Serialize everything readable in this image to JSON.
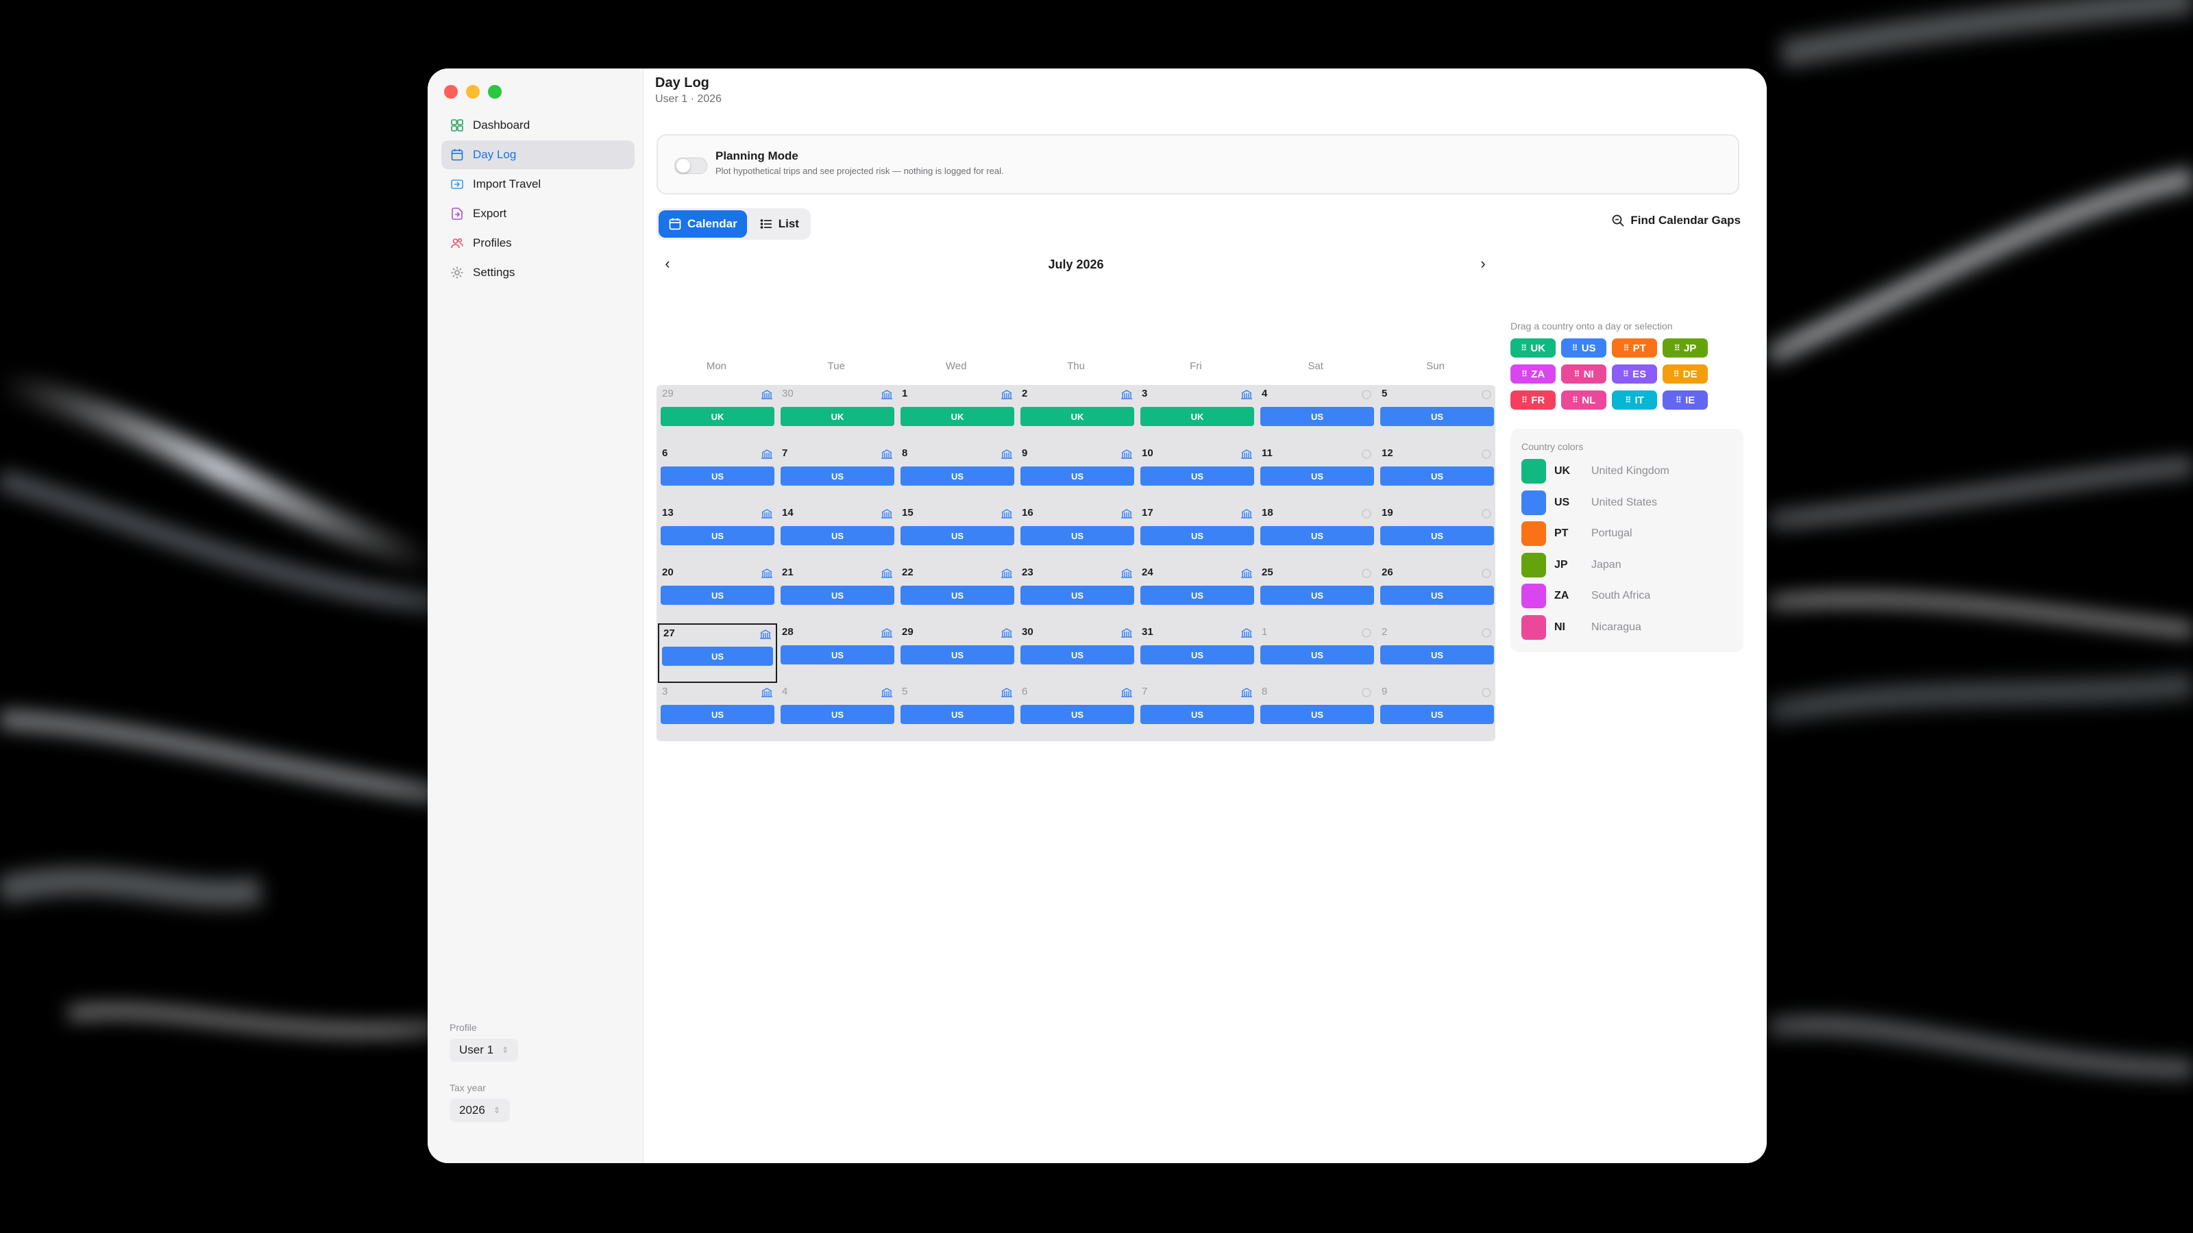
{
  "sidebar": {
    "items": [
      {
        "label": "Dashboard",
        "icon": "dashboard-icon"
      },
      {
        "label": "Day Log",
        "icon": "calendar-icon",
        "active": true
      },
      {
        "label": "Import Travel",
        "icon": "import-icon"
      },
      {
        "label": "Export",
        "icon": "export-icon"
      },
      {
        "label": "Profiles",
        "icon": "profiles-icon"
      },
      {
        "label": "Settings",
        "icon": "gear-icon"
      }
    ],
    "profile_label": "Profile",
    "profile_value": "User 1",
    "tax_year_label": "Tax year",
    "tax_year_value": "2026"
  },
  "header": {
    "title": "Day Log",
    "subtitle": "User 1 · 2026"
  },
  "planning": {
    "title": "Planning Mode",
    "description": "Plot hypothetical trips and see projected risk — nothing is logged for real.",
    "enabled": false
  },
  "view_toggle": {
    "calendar_label": "Calendar",
    "list_label": "List",
    "active": "calendar"
  },
  "find_gaps_label": "Find Calendar Gaps",
  "calendar": {
    "month_title": "July 2026",
    "weekdays": [
      "Mon",
      "Tue",
      "Wed",
      "Thu",
      "Fri",
      "Sat",
      "Sun"
    ],
    "selected_day": "27",
    "weeks": [
      [
        {
          "day": "29",
          "in_month": false,
          "country": "UK",
          "icon": true
        },
        {
          "day": "30",
          "in_month": false,
          "country": "UK",
          "icon": true
        },
        {
          "day": "1",
          "in_month": true,
          "country": "UK",
          "icon": true
        },
        {
          "day": "2",
          "in_month": true,
          "country": "UK",
          "icon": true
        },
        {
          "day": "3",
          "in_month": true,
          "country": "UK",
          "icon": true
        },
        {
          "day": "4",
          "in_month": true,
          "country": "US",
          "icon": false
        },
        {
          "day": "5",
          "in_month": true,
          "country": "US",
          "icon": false
        }
      ],
      [
        {
          "day": "6",
          "in_month": true,
          "country": "US",
          "icon": true
        },
        {
          "day": "7",
          "in_month": true,
          "country": "US",
          "icon": true
        },
        {
          "day": "8",
          "in_month": true,
          "country": "US",
          "icon": true
        },
        {
          "day": "9",
          "in_month": true,
          "country": "US",
          "icon": true
        },
        {
          "day": "10",
          "in_month": true,
          "country": "US",
          "icon": true
        },
        {
          "day": "11",
          "in_month": true,
          "country": "US",
          "icon": false
        },
        {
          "day": "12",
          "in_month": true,
          "country": "US",
          "icon": false
        }
      ],
      [
        {
          "day": "13",
          "in_month": true,
          "country": "US",
          "icon": true
        },
        {
          "day": "14",
          "in_month": true,
          "country": "US",
          "icon": true
        },
        {
          "day": "15",
          "in_month": true,
          "country": "US",
          "icon": true
        },
        {
          "day": "16",
          "in_month": true,
          "country": "US",
          "icon": true
        },
        {
          "day": "17",
          "in_month": true,
          "country": "US",
          "icon": true
        },
        {
          "day": "18",
          "in_month": true,
          "country": "US",
          "icon": false
        },
        {
          "day": "19",
          "in_month": true,
          "country": "US",
          "icon": false
        }
      ],
      [
        {
          "day": "20",
          "in_month": true,
          "country": "US",
          "icon": true
        },
        {
          "day": "21",
          "in_month": true,
          "country": "US",
          "icon": true
        },
        {
          "day": "22",
          "in_month": true,
          "country": "US",
          "icon": true
        },
        {
          "day": "23",
          "in_month": true,
          "country": "US",
          "icon": true
        },
        {
          "day": "24",
          "in_month": true,
          "country": "US",
          "icon": true
        },
        {
          "day": "25",
          "in_month": true,
          "country": "US",
          "icon": false
        },
        {
          "day": "26",
          "in_month": true,
          "country": "US",
          "icon": false
        }
      ],
      [
        {
          "day": "27",
          "in_month": true,
          "country": "US",
          "icon": true
        },
        {
          "day": "28",
          "in_month": true,
          "country": "US",
          "icon": true
        },
        {
          "day": "29",
          "in_month": true,
          "country": "US",
          "icon": true
        },
        {
          "day": "30",
          "in_month": true,
          "country": "US",
          "icon": true
        },
        {
          "day": "31",
          "in_month": true,
          "country": "US",
          "icon": true
        },
        {
          "day": "1",
          "in_month": false,
          "country": "US",
          "icon": false
        },
        {
          "day": "2",
          "in_month": false,
          "country": "US",
          "icon": false
        }
      ],
      [
        {
          "day": "3",
          "in_month": false,
          "country": "US",
          "icon": true
        },
        {
          "day": "4",
          "in_month": false,
          "country": "US",
          "icon": true
        },
        {
          "day": "5",
          "in_month": false,
          "country": "US",
          "icon": true
        },
        {
          "day": "6",
          "in_month": false,
          "country": "US",
          "icon": true
        },
        {
          "day": "7",
          "in_month": false,
          "country": "US",
          "icon": true
        },
        {
          "day": "8",
          "in_month": false,
          "country": "US",
          "icon": false
        },
        {
          "day": "9",
          "in_month": false,
          "country": "US",
          "icon": false
        }
      ]
    ]
  },
  "drag_hint": "Drag a country onto a day or selection",
  "chips": [
    {
      "code": "UK",
      "color": "#10b981"
    },
    {
      "code": "US",
      "color": "#3b82f6"
    },
    {
      "code": "PT",
      "color": "#f97316"
    },
    {
      "code": "JP",
      "color": "#65a30d"
    },
    {
      "code": "ZA",
      "color": "#d946ef"
    },
    {
      "code": "NI",
      "color": "#ec4899"
    },
    {
      "code": "ES",
      "color": "#8b5cf6"
    },
    {
      "code": "DE",
      "color": "#f59e0b"
    },
    {
      "code": "FR",
      "color": "#f43f5e"
    },
    {
      "code": "NL",
      "color": "#ec4899"
    },
    {
      "code": "IT",
      "color": "#06b6d4"
    },
    {
      "code": "IE",
      "color": "#6366f1"
    }
  ],
  "country_colors": {
    "title": "Country colors",
    "rows": [
      {
        "code": "UK",
        "name": "United Kingdom",
        "color": "#10b981"
      },
      {
        "code": "US",
        "name": "United States",
        "color": "#3b82f6"
      },
      {
        "code": "PT",
        "name": "Portugal",
        "color": "#f97316"
      },
      {
        "code": "JP",
        "name": "Japan",
        "color": "#65a30d"
      },
      {
        "code": "ZA",
        "name": "South Africa",
        "color": "#d946ef"
      },
      {
        "code": "NI",
        "name": "Nicaragua",
        "color": "#ec4899"
      }
    ]
  },
  "colors": {
    "accent": "#1a73e8",
    "uk_bar": "#10b981",
    "us_bar": "#3b82f6"
  }
}
